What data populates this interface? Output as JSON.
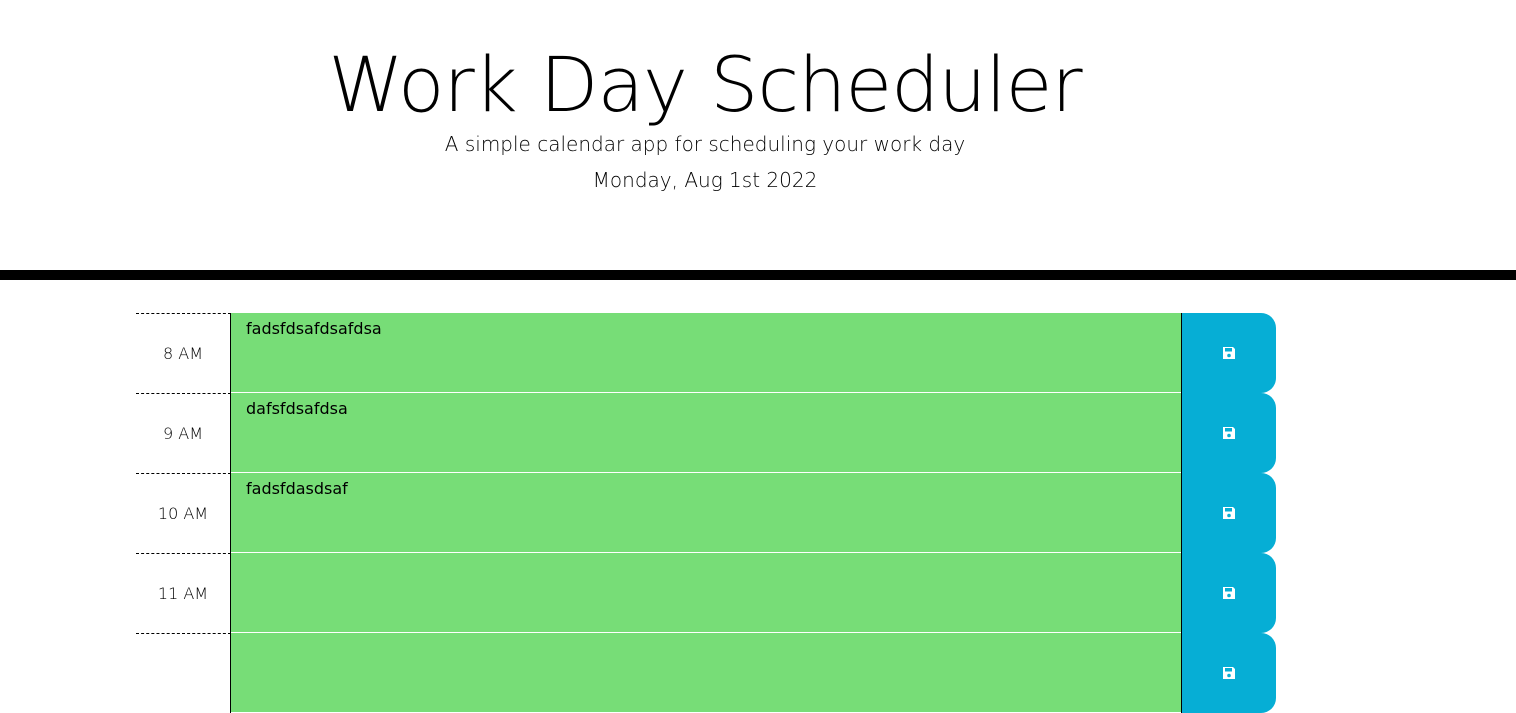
{
  "header": {
    "title": "Work Day Scheduler",
    "lead": "A simple calendar app for scheduling your work day",
    "current_day": "Monday, Aug 1st 2022"
  },
  "colors": {
    "present": "#77dd77",
    "save_button": "#06aed5"
  },
  "time_blocks": [
    {
      "hour": "8 AM",
      "text": "fadsfdsafdsafdsa",
      "icon": "save-icon"
    },
    {
      "hour": "9 AM",
      "text": "dafsfdsafdsa",
      "icon": "save-icon"
    },
    {
      "hour": "10 AM",
      "text": "fadsfdasdsaf",
      "icon": "save-icon"
    },
    {
      "hour": "11 AM",
      "text": "",
      "icon": "save-icon"
    },
    {
      "hour": "",
      "text": "",
      "icon": "save-icon"
    }
  ]
}
